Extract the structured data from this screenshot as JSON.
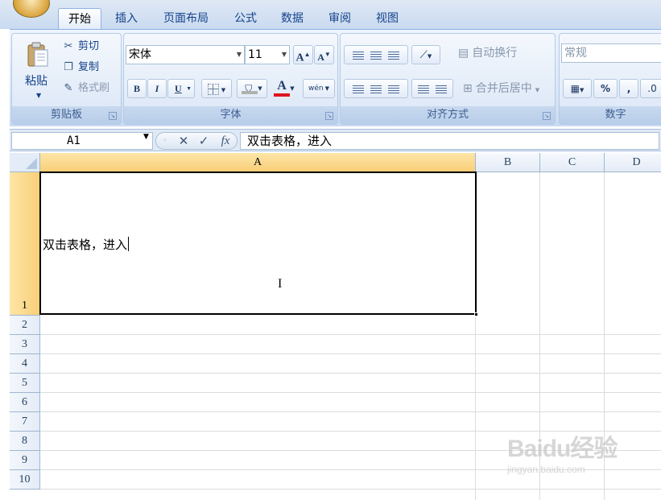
{
  "ribbon": {
    "tabs": [
      "开始",
      "插入",
      "页面布局",
      "公式",
      "数据",
      "审阅",
      "视图"
    ],
    "active_tab": "开始",
    "clipboard": {
      "label": "剪贴板",
      "paste": "粘贴",
      "cut": "剪切",
      "copy": "复制",
      "format_painter": "格式刷"
    },
    "font": {
      "label": "字体",
      "name": "宋体",
      "size": "11",
      "grow": "A",
      "shrink": "A",
      "bold": "B",
      "italic": "I",
      "underline": "U",
      "font_color": "A",
      "phonetic": "wén",
      "font_color_hex": "#e0141e"
    },
    "alignment": {
      "label": "对齐方式",
      "wrap_text": "自动换行",
      "merge_center": "合并后居中"
    },
    "number": {
      "label": "数字",
      "format": "常规",
      "percent": "%",
      "comma": ","
    }
  },
  "formula_bar": {
    "name_box": "A1",
    "cancel": "✕",
    "enter": "✓",
    "fx": "fx",
    "content": "双击表格，进入"
  },
  "sheet": {
    "columns": [
      "A",
      "B",
      "C",
      "D"
    ],
    "selected_column": "A",
    "rows": [
      "1",
      "2",
      "3",
      "4",
      "5",
      "6",
      "7",
      "8",
      "9",
      "10"
    ],
    "selected_row": "1",
    "cell_a1": "双击表格，进入"
  },
  "watermark": {
    "text": "Baidu经验",
    "url": "jingyan.baidu.com"
  }
}
